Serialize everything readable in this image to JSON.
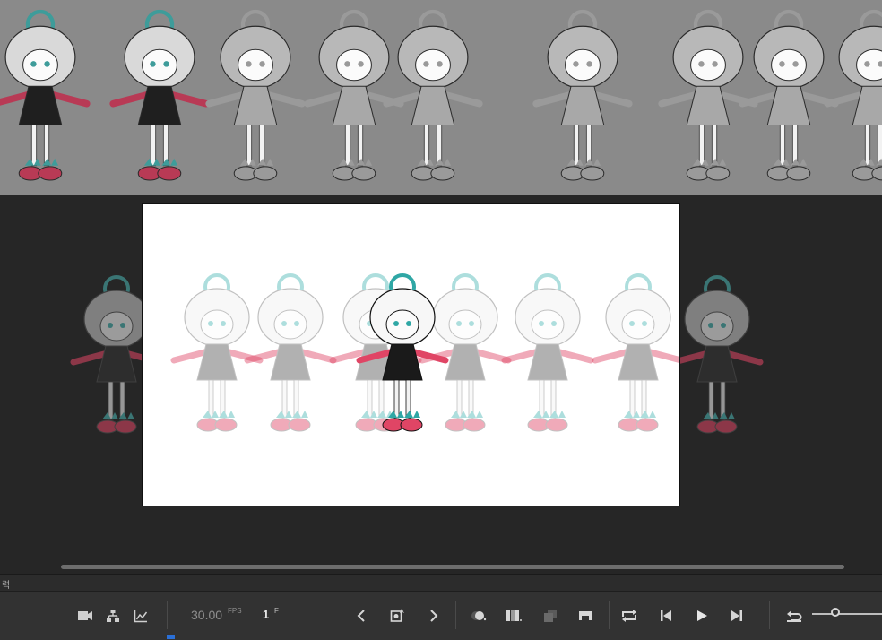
{
  "timeline": {
    "strip_label": "력",
    "fps_value": "30.00",
    "fps_unit": "FPS",
    "frame_value": "1",
    "frame_unit": "F"
  },
  "colors": {
    "reference_bg": "#8a8a8a",
    "pasteboard_bg": "#262626",
    "stage_bg": "#ffffff",
    "toolbar_bg": "#323232",
    "accent_teal": "#4bb7b5",
    "accent_pink": "#e04565",
    "playhead_blue": "#2a6fd6"
  },
  "icons": [
    "camera-icon",
    "layer-hierarchy-icon",
    "graph-icon",
    "previous-keyframe-icon",
    "auto-keyframe-icon",
    "next-keyframe-icon",
    "onion-skin-icon",
    "onion-skin-outline-icon",
    "edit-multiple-frames-icon",
    "insert-frame-icon",
    "loop-icon",
    "step-back-icon",
    "play-icon",
    "step-forward-icon",
    "undo-icon",
    "zoom-slider-icon"
  ]
}
